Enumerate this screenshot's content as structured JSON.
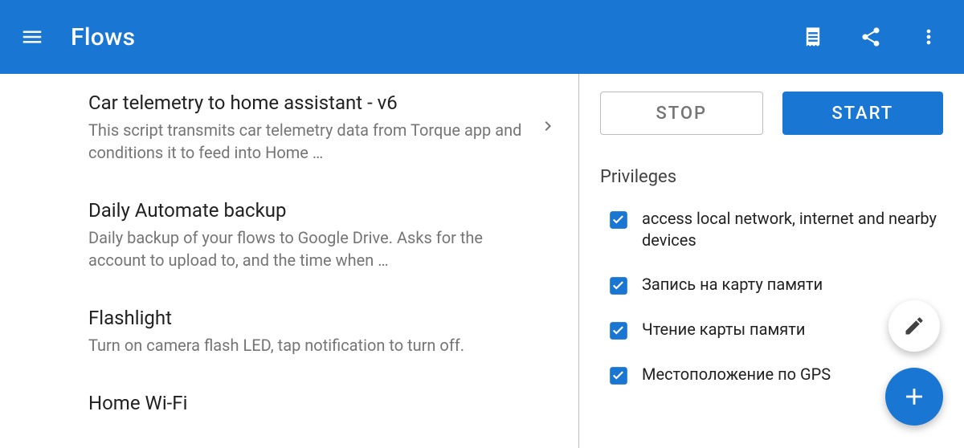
{
  "appbar": {
    "title": "Flows"
  },
  "flows": [
    {
      "title": "Car telemetry to home assistant - v6",
      "desc": "This script transmits car telemetry data from Torque app and conditions it to feed into Home …",
      "selected": true
    },
    {
      "title": "Daily Automate backup",
      "desc": "Daily backup of your flows to Google Drive. Asks for the account to upload to, and the time when …",
      "selected": false
    },
    {
      "title": "Flashlight",
      "desc": "Turn on camera flash LED, tap notification to turn off.",
      "selected": false
    },
    {
      "title": "Home Wi-Fi",
      "desc": "",
      "selected": false
    }
  ],
  "buttons": {
    "stop": "STOP",
    "start": "START"
  },
  "privileges": {
    "heading": "Privileges",
    "items": [
      {
        "label": "access local network, internet and nearby devices",
        "checked": true
      },
      {
        "label": "Запись на карту памяти",
        "checked": true
      },
      {
        "label": "Чтение карты памяти",
        "checked": true
      },
      {
        "label": "Местоположение по GPS",
        "checked": true
      }
    ]
  }
}
